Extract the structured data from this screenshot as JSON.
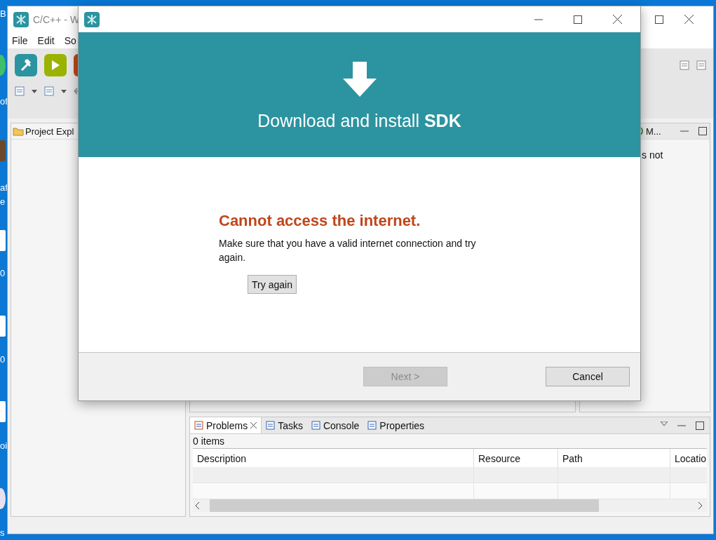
{
  "desktop": {
    "labels": [
      "B",
      "of",
      "af",
      "e",
      "0",
      "0",
      "oi",
      "s"
    ]
  },
  "ide": {
    "title": "C/C++ - W",
    "menu": [
      "File",
      "Edit",
      "So"
    ],
    "project_explorer": {
      "title": "Project Expl"
    },
    "side_panel": {
      "tab": "M...",
      "text": "s not"
    },
    "bottom_panel": {
      "tabs": [
        {
          "label": "Problems",
          "selected": true,
          "closable": true
        },
        {
          "label": "Tasks",
          "selected": false,
          "closable": false
        },
        {
          "label": "Console",
          "selected": false,
          "closable": false
        },
        {
          "label": "Properties",
          "selected": false,
          "closable": false
        }
      ],
      "status": "0 items",
      "columns": [
        "Description",
        "Resource",
        "Path",
        "Locatio"
      ]
    }
  },
  "dialog": {
    "banner": {
      "title": "Download and install **SDK**"
    },
    "error": {
      "heading": "Cannot access the internet.",
      "message": "Make sure that you have a valid internet connection and try again."
    },
    "retry_button": "Try again",
    "buttons": [
      {
        "label": "Next >",
        "disabled": true
      },
      {
        "label": "Cancel",
        "disabled": false
      }
    ]
  }
}
